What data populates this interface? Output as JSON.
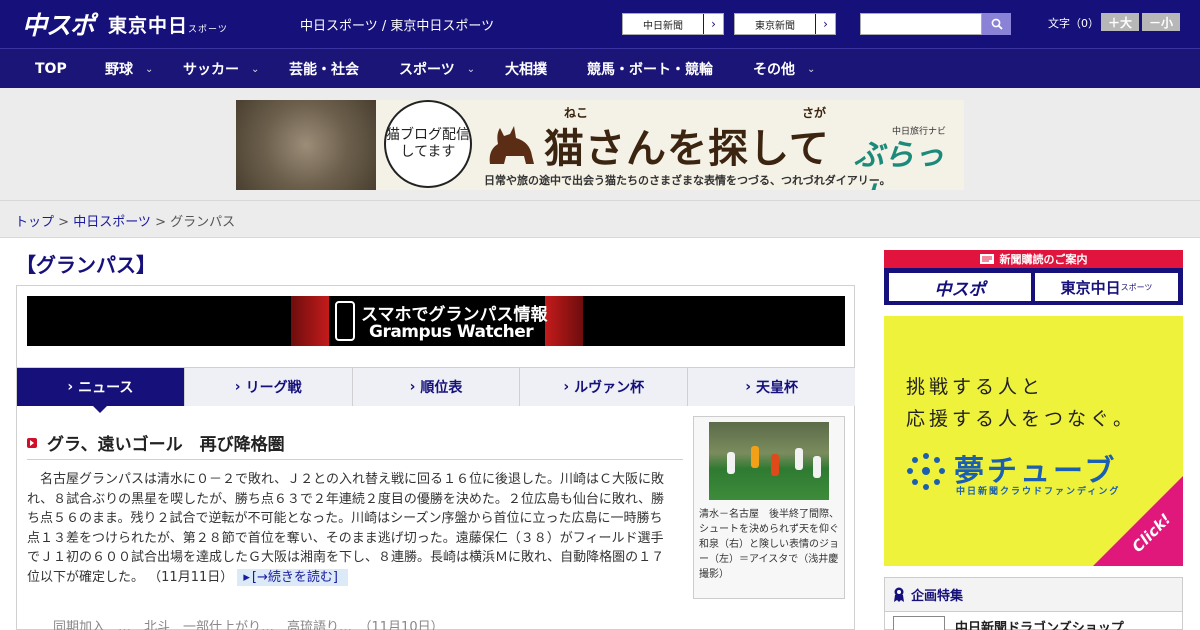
{
  "header": {
    "logo_primary": "中スポ",
    "logo_secondary": "東京中日",
    "logo_secondary_small": "スポーツ",
    "site_names": "中日スポーツ / 東京中日スポーツ",
    "link_chunichi": "中日新聞",
    "link_tokyo": "東京新聞",
    "search_placeholder": "",
    "font_size_label": "文字（0）",
    "font_plus": "＋大",
    "font_minus": "－小"
  },
  "nav": {
    "items": [
      {
        "label": "TOP",
        "has_dropdown": false
      },
      {
        "label": "野球",
        "has_dropdown": true
      },
      {
        "label": "サッカー",
        "has_dropdown": true
      },
      {
        "label": "芸能・社会",
        "has_dropdown": false
      },
      {
        "label": "スポーツ",
        "has_dropdown": true
      },
      {
        "label": "大相撲",
        "has_dropdown": false
      },
      {
        "label": "競馬・ボート・競輪",
        "has_dropdown": false
      },
      {
        "label": "その他",
        "has_dropdown": true
      }
    ],
    "chevron": "⌄"
  },
  "banner_ad": {
    "bubble_text": "猫ブログ配信してます",
    "title": "猫さんを探して",
    "ruby1": "ねこ",
    "ruby2": "さが",
    "brand_sub": "中日旅行ナビ",
    "brand": "ぶらっ人",
    "caption": "日常や旅の途中で出会う猫たちのさまざまな表情をつづる、つれづれダイアリー。"
  },
  "breadcrumb": {
    "top": "トップ",
    "sep1": " > ",
    "section": "中日スポーツ",
    "sep2": " > ",
    "current": "グランパス"
  },
  "page": {
    "title": "【グランパス】"
  },
  "gw_banner": {
    "line1": "スマホでグランパス情報",
    "line2": "Grampus Watcher"
  },
  "tabs": [
    {
      "label": "ニュース",
      "active": true
    },
    {
      "label": "リーグ戦",
      "active": false
    },
    {
      "label": "順位表",
      "active": false
    },
    {
      "label": "ルヴァン杯",
      "active": false
    },
    {
      "label": "天皇杯",
      "active": false
    }
  ],
  "tab_prefix": "›",
  "article": {
    "title": "グラ、遠いゴール　再び降格圏",
    "body": "名古屋グランパスは清水に０－２で敗れ、Ｊ２との入れ替え戦に回る１６位に後退した。川崎はＣ大阪に敗れ、８試合ぶりの黒星を喫したが、勝ち点６３で２年連続２度目の優勝を決めた。２位広島も仙台に敗れ、勝ち点５６のまま。残り２試合で逆転が不可能となった。川崎はシーズン序盤から首位に立った広島に一時勝ち点１３差をつけられたが、第２８節で首位を奪い、そのまま逃げ切った。遠藤保仁（３８）がフィールド選手でＪ１初の６００試合出場を達成したＧ大阪は湘南を下し、８連勝。長崎は横浜Ｍに敗れ、自動降格圏の１７位以下が確定した。",
    "date": "（11月11日）",
    "read_more": "[→続きを読む]",
    "photo_caption": "清水－名古屋　後半終了間際、シュートを決められず天を仰ぐ和泉（右）と険しい表情のジョー（左）＝アイスタで（浅井慶撮影）"
  },
  "next_article_preview": "　　同期加入　…　北斗　一部仕上がり…　高琉語り…　（11月10日）",
  "sidebar": {
    "subscribe_header": "新聞購読のご案内",
    "subscribe_chusupo": "中スポ",
    "subscribe_tokyo": "東京中日",
    "subscribe_tokyo_small": "スポーツ",
    "yume_line1": "挑戦する人と",
    "yume_line2": "応援する人をつなぐ。",
    "yume_brand": "夢チューブ",
    "yume_sub": "中日新聞クラウドファンディング",
    "yume_click": "Click!",
    "feature_title": "企画特集",
    "feature_item": "中日新聞ドラゴンズショップ"
  },
  "colors": {
    "brand_navy": "#16107a",
    "accent_red": "#e0143c",
    "yume_yellow": "#eef23a",
    "yume_blue": "#1a5fb0",
    "click_pink": "#e0187c"
  }
}
